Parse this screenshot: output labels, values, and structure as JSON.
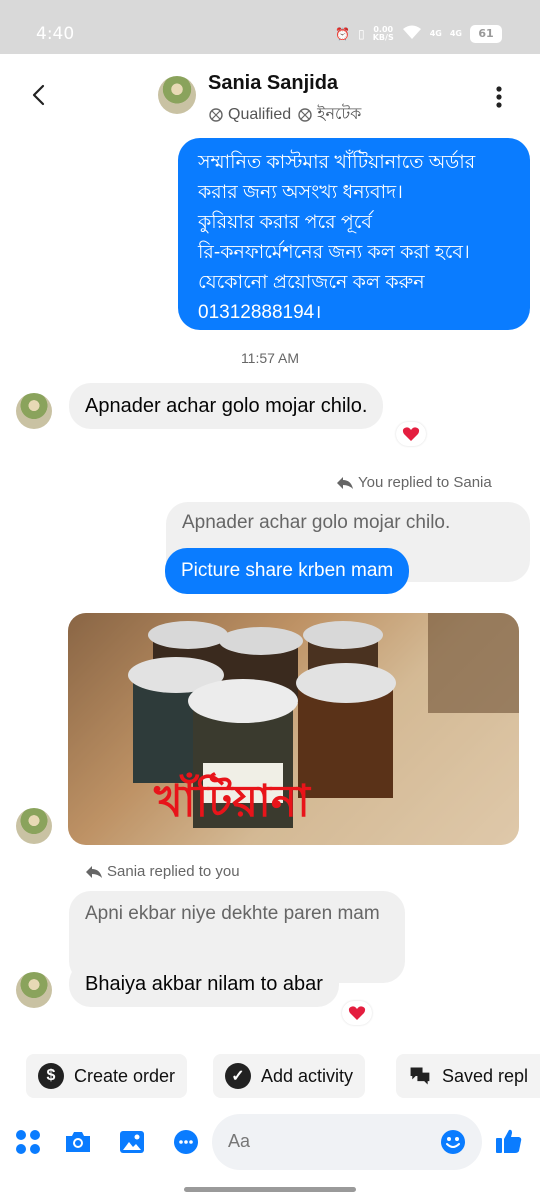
{
  "status_bar": {
    "time": "4:40",
    "net_speed_value": "0.00",
    "net_speed_unit": "KB/S",
    "signal1": "4G",
    "signal2": "4G",
    "battery": "61"
  },
  "header": {
    "name": "Sania Sanjida",
    "tag1": "Qualified",
    "tag2": "ইনটেক"
  },
  "messages": {
    "outgoing_intro_lines": [
      "সম্মানিত কাস্টমার খাঁটিয়ানাতে অর্ডার",
      "করার জন্য অসংখ্য ধন্যবাদ।",
      "কুরিয়ার করার পরে পূর্বে",
      "রি-কনফার্মেশনের জন্য কল করা হবে।",
      "যেকোনো প্রয়োজনে কল করুন",
      "01312888194।"
    ],
    "timestamp": "11:57 AM",
    "incoming_1": "Apnader achar golo mojar chilo.",
    "reply_label_out": "You replied to Sania",
    "quoted_out": "Apnader achar golo mojar chilo.",
    "outgoing_2": "Picture share krben mam",
    "photo_caption": "খাঁটিয়ানা",
    "reply_label_in": "Sania replied to you",
    "quoted_in": "Apni ekbar niye dekhte paren mam",
    "incoming_2": "Bhaiya akbar nilam to abar"
  },
  "actions": {
    "create_order": "Create order",
    "add_activity": "Add activity",
    "saved_replies": "Saved repl"
  },
  "composer": {
    "placeholder": "Aa"
  },
  "colors": {
    "messenger_blue": "#0a7cff",
    "incoming_bubble": "#f0f0f0",
    "reaction_heart": "#e41e3f"
  }
}
